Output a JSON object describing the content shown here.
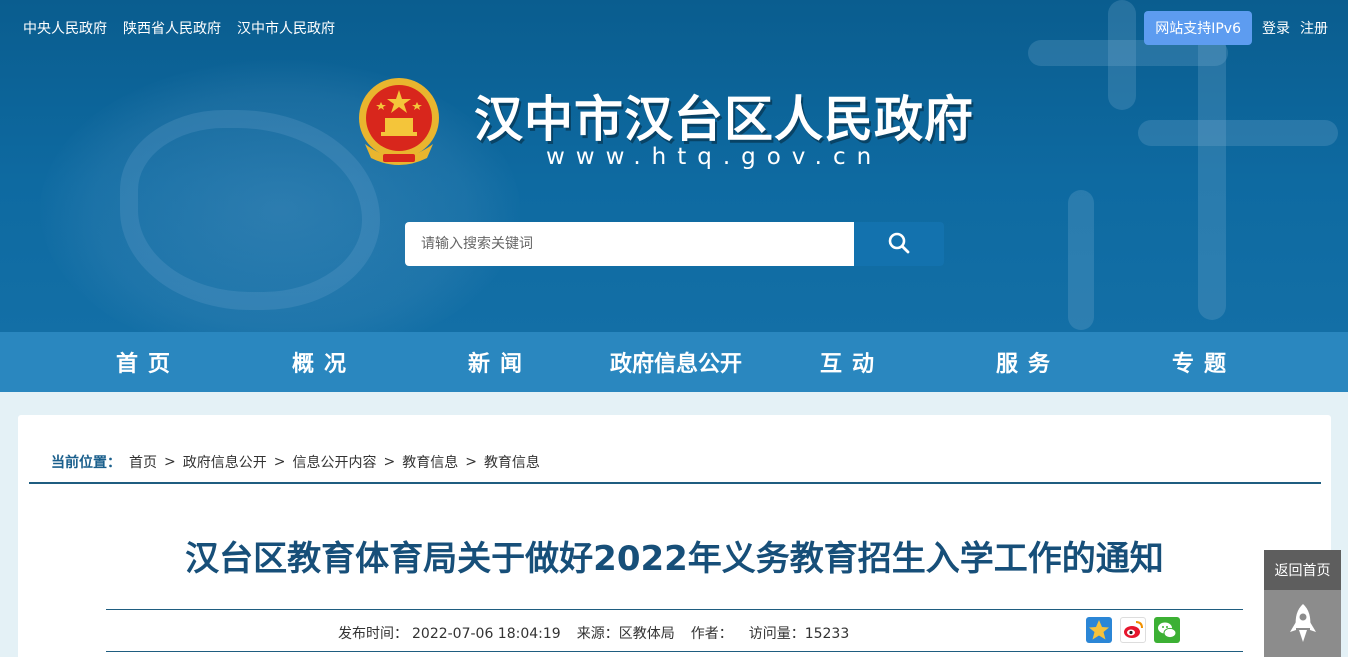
{
  "header": {
    "top_links": [
      "中央人民政府",
      "陕西省人民政府",
      "汉中市人民政府"
    ],
    "ipv6_badge": "网站支持IPv6",
    "login": "登录",
    "register": "注册",
    "site_title": "汉中市汉台区人民政府",
    "site_url": "www.htq.gov.cn",
    "search_placeholder": "请输入搜索关键词"
  },
  "nav": {
    "items": [
      "首页",
      "概况",
      "新闻",
      "政府信息公开",
      "互动",
      "服务",
      "专题"
    ]
  },
  "breadcrumb": {
    "label": "当前位置：",
    "items": [
      "首页",
      "政府信息公开",
      "信息公开内容",
      "教育信息",
      "教育信息"
    ],
    "sep": ">"
  },
  "article": {
    "title": "汉台区教育体育局关于做好2022年义务教育招生入学工作的通知",
    "publish_label": "发布时间：",
    "publish_time": "2022-07-06 18:04:19",
    "source_label": "来源：",
    "source": "区教体局",
    "author_label": "作者：",
    "author": "",
    "views_label": "访问量：",
    "views": "15233"
  },
  "float": {
    "back_home": "返回首页"
  },
  "colors": {
    "header_bg": "#0e6aa1",
    "nav_bg": "#2a87bf",
    "title_color": "#174f79",
    "page_bg": "#e4f1f6"
  },
  "icons": [
    "search-icon",
    "qzone-icon",
    "weibo-icon",
    "wechat-icon",
    "rocket-icon"
  ]
}
